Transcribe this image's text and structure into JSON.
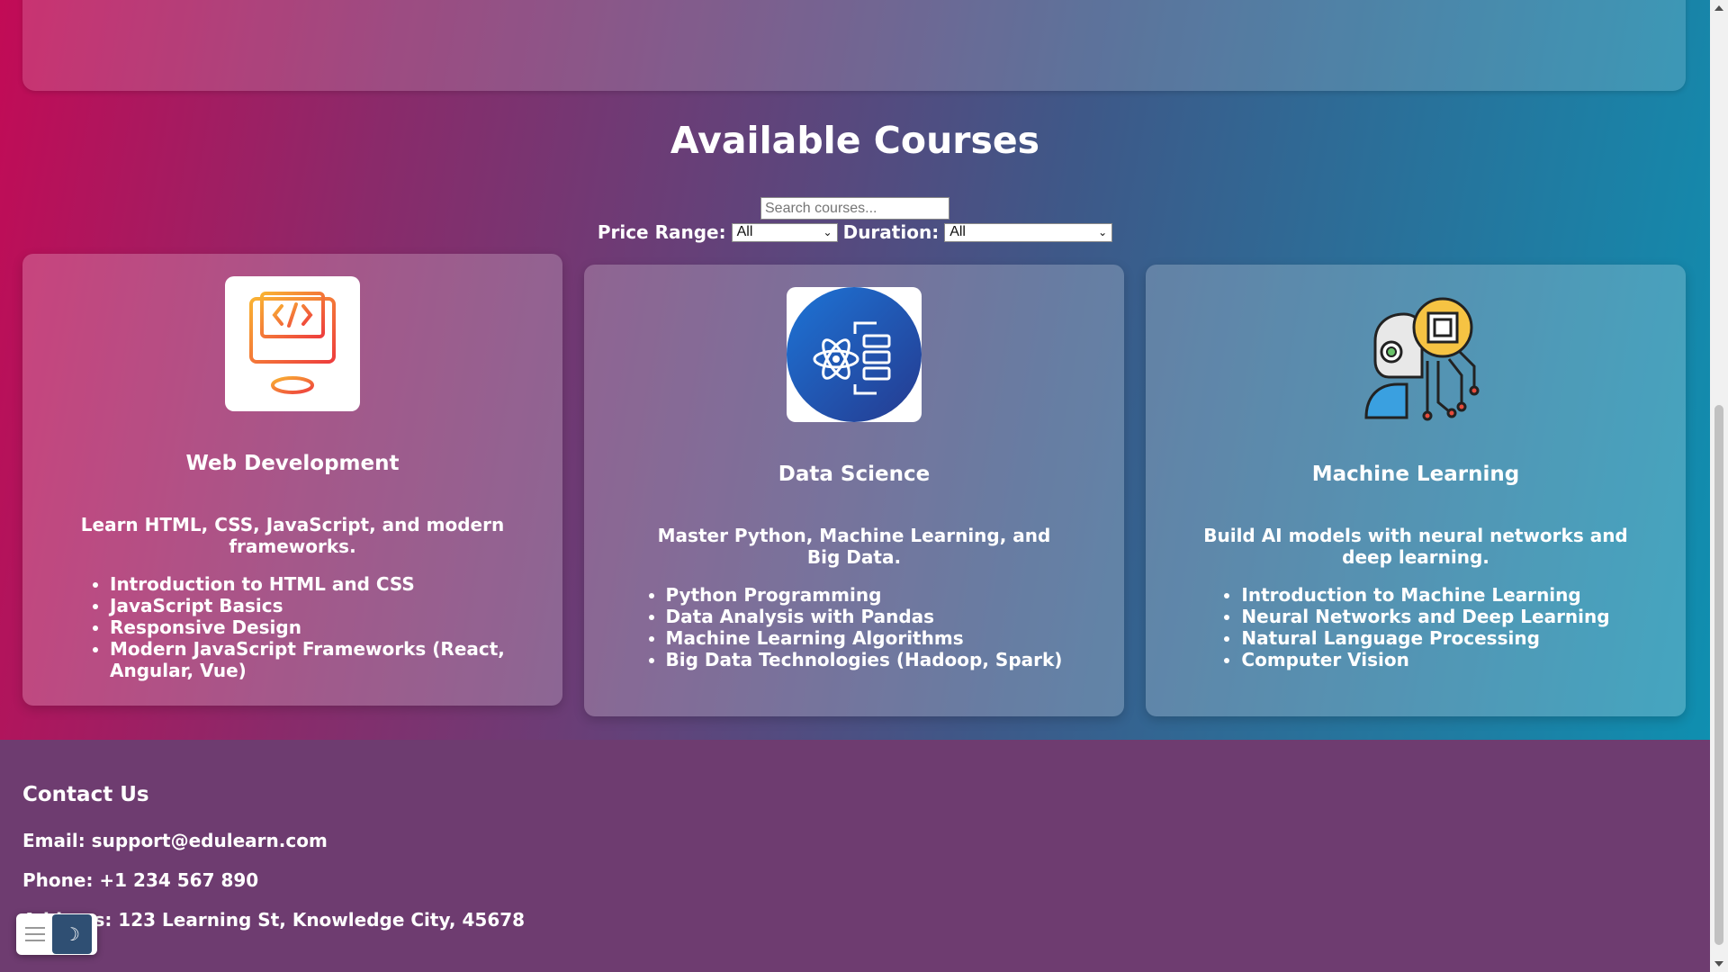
{
  "section": {
    "title": "Available Courses",
    "search_placeholder": "Search courses...",
    "price_label": "Price Range:",
    "price_value": "All",
    "duration_label": "Duration:",
    "duration_value": "All"
  },
  "courses": [
    {
      "icon": "code-monitor-icon",
      "title": "Web Development",
      "description": "Learn HTML, CSS, JavaScript, and modern frameworks.",
      "topics": [
        "Introduction to HTML and CSS",
        "JavaScript Basics",
        "Responsive Design",
        "Modern JavaScript Frameworks (React, Angular, Vue)"
      ]
    },
    {
      "icon": "data-science-icon",
      "title": "Data Science",
      "description": "Master Python, Machine Learning, and Big Data.",
      "topics": [
        "Python Programming",
        "Data Analysis with Pandas",
        "Machine Learning Algorithms",
        "Big Data Technologies (Hadoop, Spark)"
      ]
    },
    {
      "icon": "ai-robot-icon",
      "title": "Machine Learning",
      "description": "Build AI models with neural networks and deep learning.",
      "topics": [
        "Introduction to Machine Learning",
        "Neural Networks and Deep Learning",
        "Natural Language Processing",
        "Computer Vision"
      ]
    }
  ],
  "footer": {
    "title": "Contact Us",
    "email": "Email: support@edulearn.com",
    "phone": "Phone: +1 234 567 890",
    "address": "Address: 123 Learning St, Knowledge City, 45678"
  },
  "controls": {
    "menu_icon": "menu-icon",
    "theme_icon": "moon-icon",
    "theme_glyph": "☽"
  },
  "colors": {
    "gradient_start": "#c20b56",
    "gradient_end": "#0f8fb0",
    "footer_bg": "#6e3c70"
  }
}
